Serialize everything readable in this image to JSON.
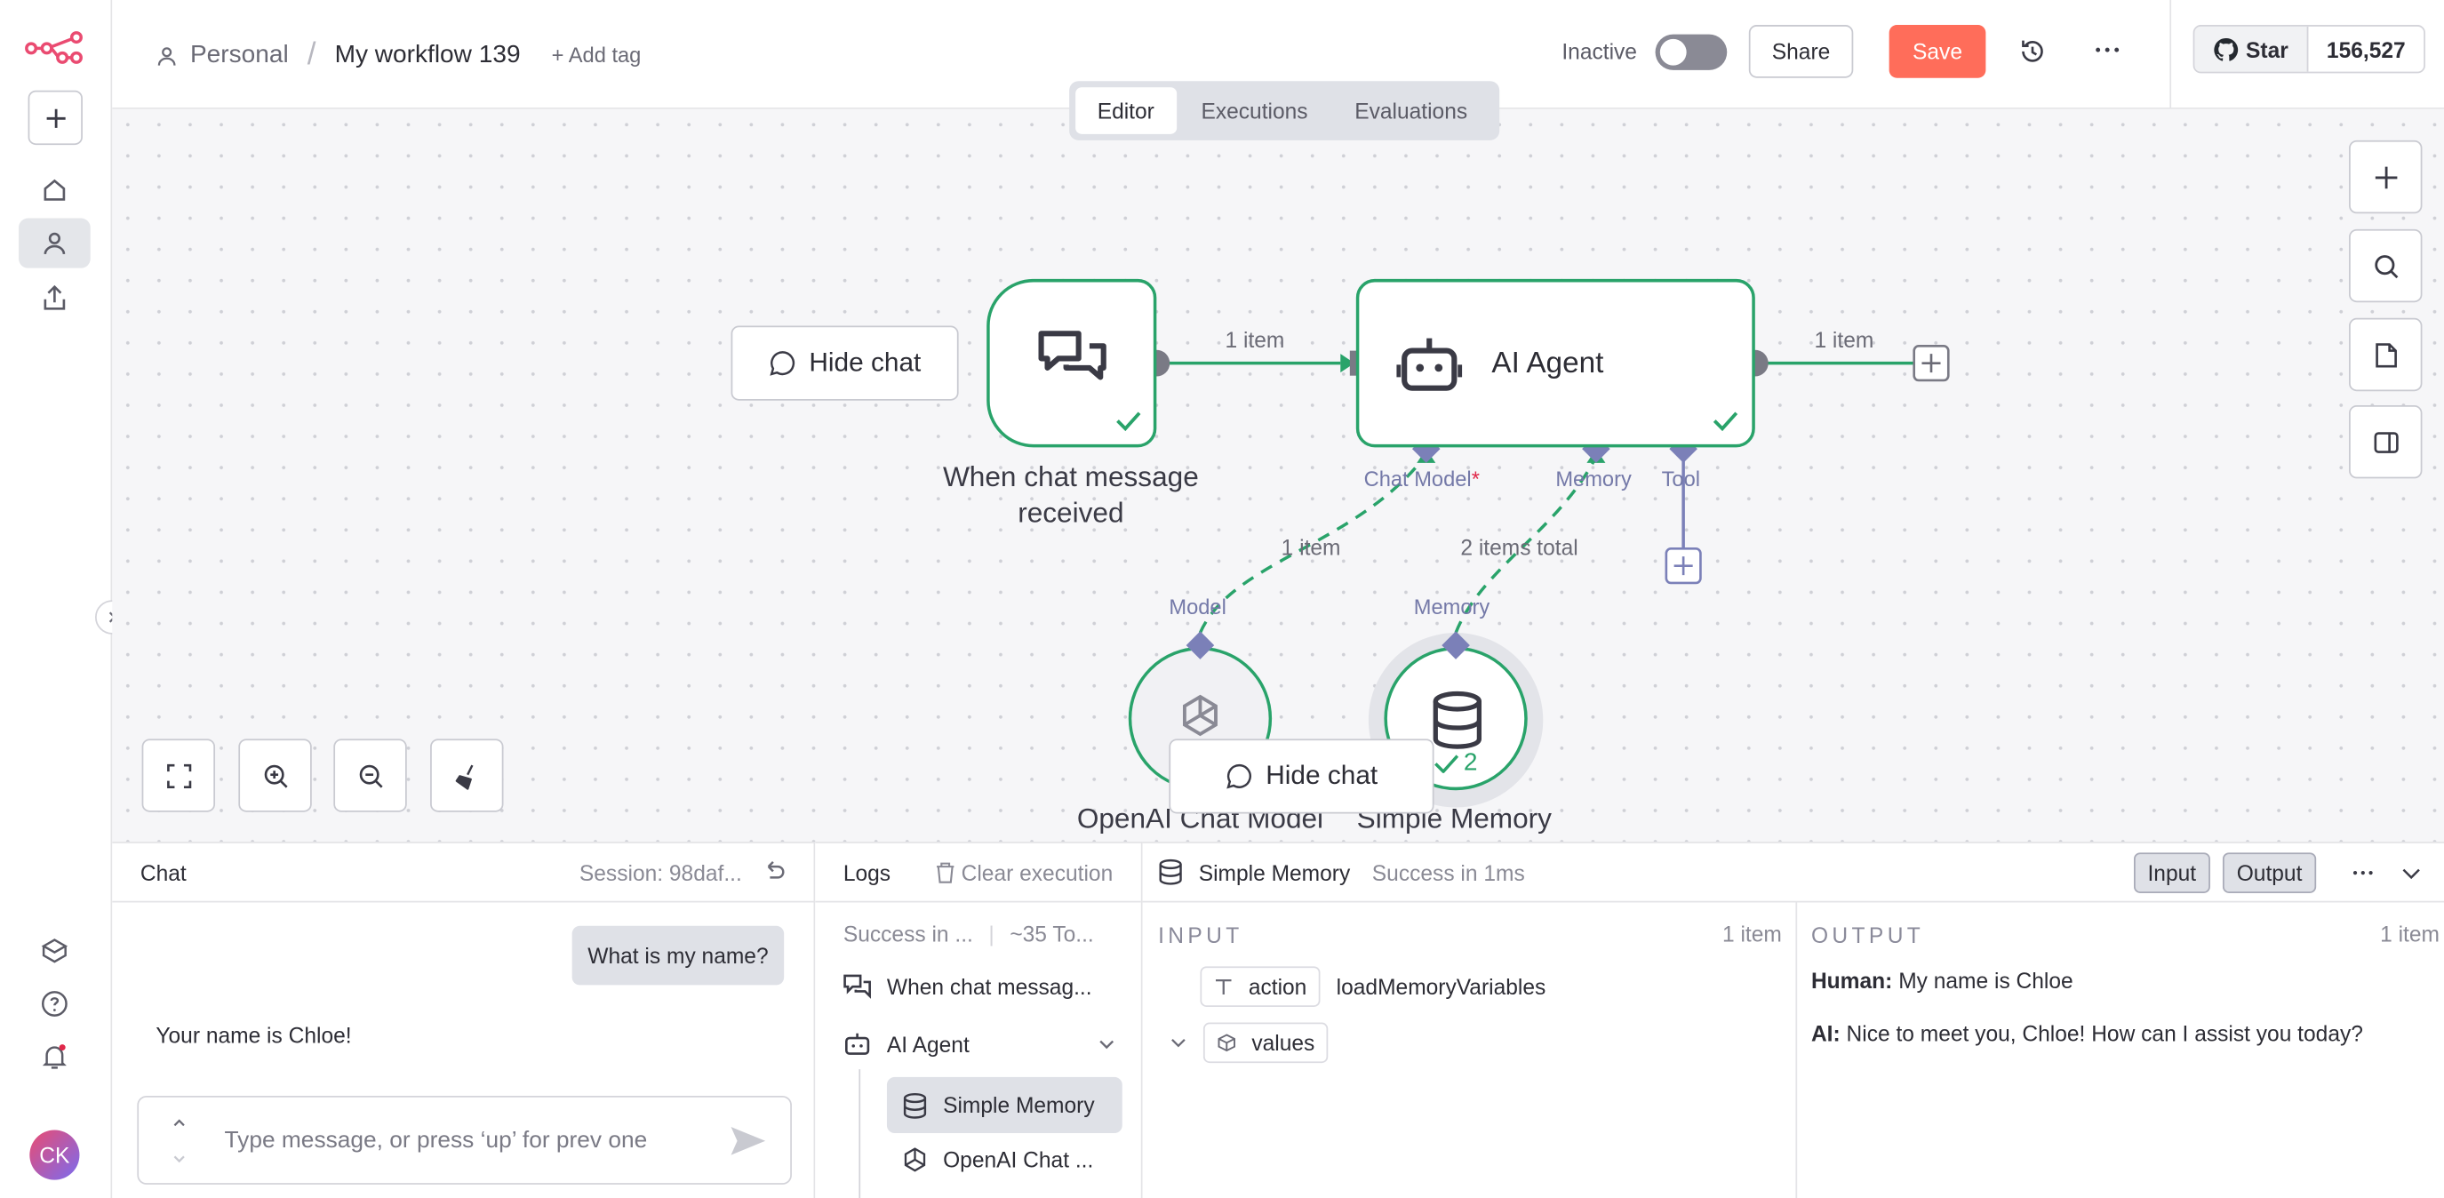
{
  "sidebar": {
    "avatar_initials": "CK"
  },
  "header": {
    "breadcrumb_project": "Personal",
    "breadcrumb_sep": "/",
    "workflow_name": "My workflow 139",
    "add_tag": "+ Add tag",
    "status_label": "Inactive",
    "active": false,
    "share_label": "Share",
    "save_label": "Save",
    "github_star_label": "Star",
    "github_star_count": "156,527"
  },
  "tabs": [
    {
      "label": "Editor",
      "active": true
    },
    {
      "label": "Executions",
      "active": false
    },
    {
      "label": "Evaluations",
      "active": false
    }
  ],
  "canvas": {
    "hide_chat_label": "Hide chat",
    "nodes": {
      "trigger": {
        "label": "When chat message received"
      },
      "agent": {
        "label": "AI Agent",
        "port_chat_model": "Chat Model",
        "port_required_mark": "*",
        "port_memory": "Memory",
        "port_tool": "Tool"
      },
      "openai": {
        "label": "OpenAI Chat Model",
        "port_label": "Model"
      },
      "memory": {
        "label": "Simple Memory",
        "port_label": "Memory",
        "run_count": "2"
      }
    },
    "edges": {
      "trigger_to_agent": "1 item",
      "agent_out": "1 item",
      "model_to_agent": "1 item",
      "memory_to_agent": "2 items total"
    }
  },
  "chat_panel": {
    "title": "Chat",
    "session": "Session: 98daf...",
    "messages": [
      {
        "role": "user",
        "text": "What is my name?"
      },
      {
        "role": "ai",
        "text": "Your name is Chloe!"
      }
    ],
    "input_placeholder": "Type message, or press ‘up’ for prev one"
  },
  "logs_panel": {
    "title": "Logs",
    "clear_label": "Clear execution",
    "status_summary": "Success in ...",
    "tokens_summary": "~35 To...",
    "items": [
      {
        "label": "When chat messag...",
        "icon": "chat-icon"
      },
      {
        "label": "AI Agent",
        "icon": "robot-icon"
      },
      {
        "label": "Simple Memory",
        "icon": "database-icon",
        "selected": true
      },
      {
        "label": "OpenAI Chat ...",
        "icon": "openai-icon"
      }
    ]
  },
  "detail_panel": {
    "node_name": "Simple Memory",
    "status": "Success in 1ms",
    "input_btn": "Input",
    "output_btn": "Output",
    "input": {
      "heading": "INPUT",
      "count": "1 item",
      "rows": [
        {
          "key": "action",
          "value": "loadMemoryVariables"
        },
        {
          "key": "values",
          "value": ""
        }
      ]
    },
    "output": {
      "heading": "OUTPUT",
      "count": "1 item",
      "lines": [
        {
          "speaker": "Human:",
          "text": "My name is Chloe"
        },
        {
          "speaker": "AI:",
          "text": "Nice to meet you, Chloe! How can I assist you today?"
        }
      ]
    }
  },
  "colors": {
    "accent": "#ff6d5a",
    "success": "#29a36a",
    "port": "#7b80b8",
    "logo": "#ea4b71"
  }
}
